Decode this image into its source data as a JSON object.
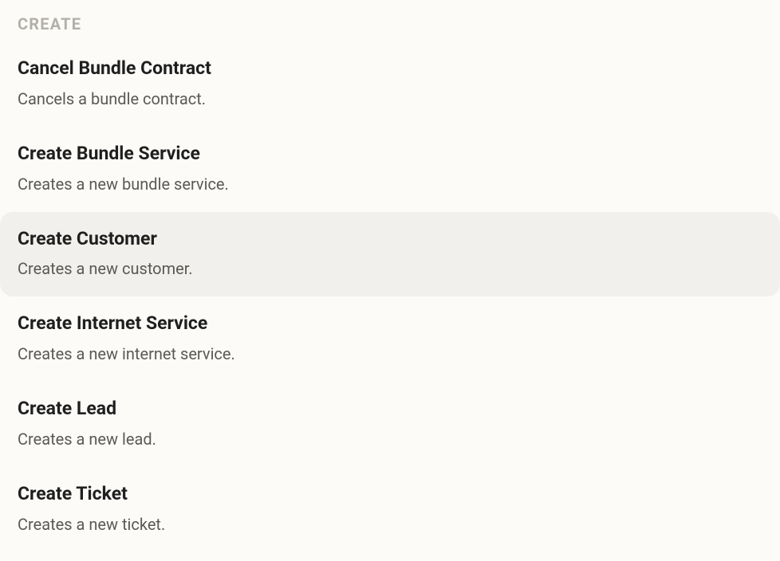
{
  "section_header": "CREATE",
  "items": [
    {
      "title": "Cancel Bundle Contract",
      "description": "Cancels a bundle contract.",
      "selected": false
    },
    {
      "title": "Create Bundle Service",
      "description": "Creates a new bundle service.",
      "selected": false
    },
    {
      "title": "Create Customer",
      "description": "Creates a new customer.",
      "selected": true
    },
    {
      "title": "Create Internet Service",
      "description": "Creates a new internet service.",
      "selected": false
    },
    {
      "title": "Create Lead",
      "description": "Creates a new lead.",
      "selected": false
    },
    {
      "title": "Create Ticket",
      "description": "Creates a new ticket.",
      "selected": false
    }
  ]
}
